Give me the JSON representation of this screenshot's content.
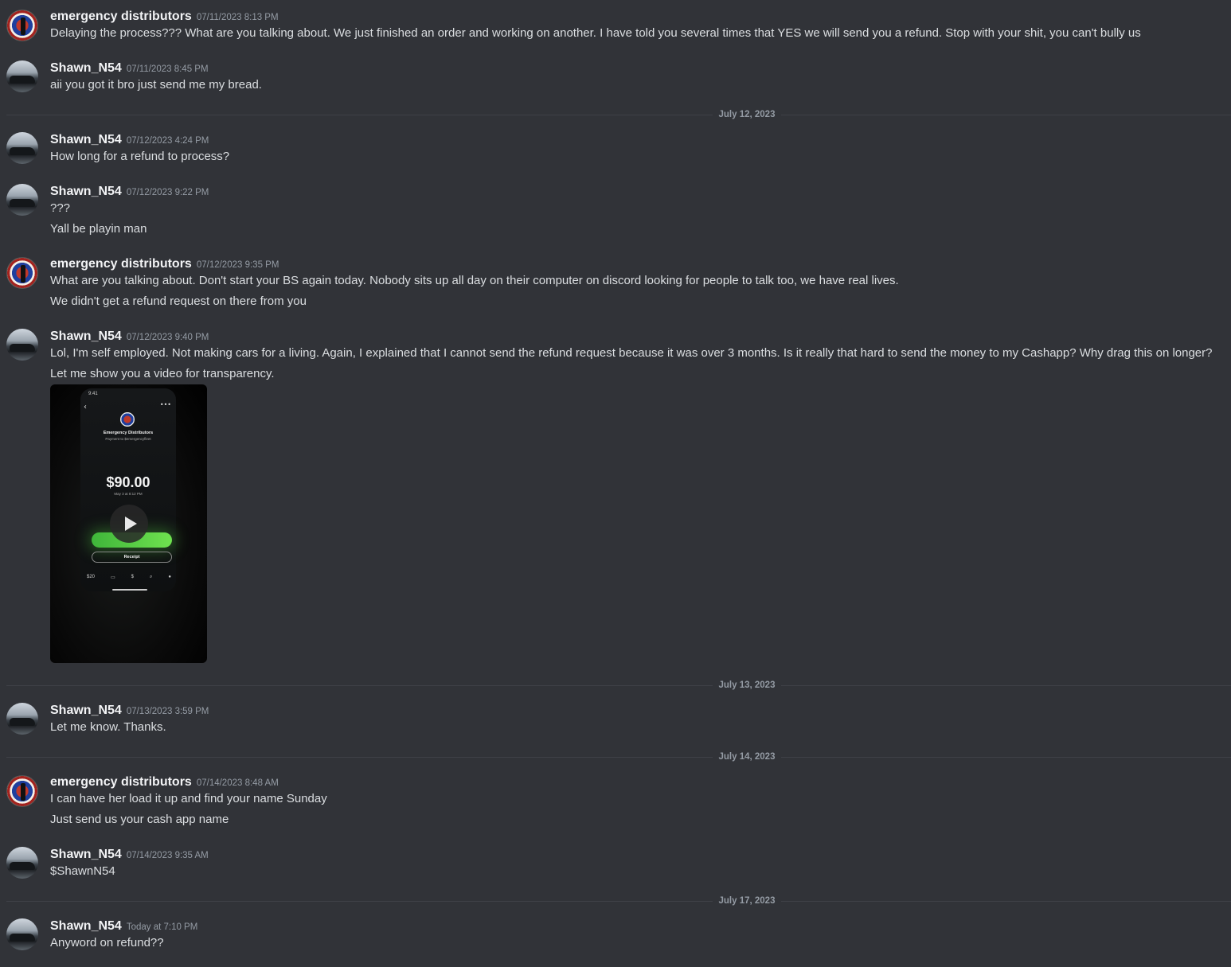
{
  "messages": [
    {
      "author": "emergency distributors",
      "avatar": "emergency-distributors-logo",
      "timestamp": "07/11/2023 8:13 PM",
      "lines": [
        "Delaying the process??? What are you talking about. We just finished an order and working on another. I have told you several times that YES we will send you a refund. Stop with your shit,  you can't bully us"
      ]
    },
    {
      "author": "Shawn_N54",
      "avatar": "car-photo",
      "timestamp": "07/11/2023 8:45 PM",
      "lines": [
        "aii you got it bro just send me my bread."
      ]
    },
    {
      "author": "Shawn_N54",
      "avatar": "car-photo",
      "timestamp": "07/12/2023 4:24 PM",
      "lines": [
        "How long for a refund to process?"
      ]
    },
    {
      "author": "Shawn_N54",
      "avatar": "car-photo",
      "timestamp": "07/12/2023 9:22 PM",
      "lines": [
        "???",
        "Yall be playin man"
      ]
    },
    {
      "author": "emergency distributors",
      "avatar": "emergency-distributors-logo",
      "timestamp": "07/12/2023 9:35 PM",
      "lines": [
        "What are you talking about. Don't start your BS again today.  Nobody sits up all day on their computer on discord looking for people to talk too, we have real lives.",
        "We didn't get a refund  request on there from you"
      ]
    },
    {
      "author": "Shawn_N54",
      "avatar": "car-photo",
      "timestamp": "07/12/2023 9:40 PM",
      "lines": [
        "Lol, I'm self employed. Not making cars for a living. Again, I explained that I cannot send the refund request because it was over 3 months. Is it really that hard to send the money to my Cashapp? Why drag this on longer?",
        "Let me show you a video for transparency."
      ],
      "video": {
        "status_time": "9:41",
        "merchant": "Emergency Distributors",
        "subtitle": "Payment to $emergencyfleet",
        "amount": "$90.00",
        "date": "May 3 at 8:12 PM",
        "receipt": "Receipt",
        "nav": [
          "$20",
          "▭",
          "$",
          "⌕",
          "●"
        ]
      }
    },
    {
      "author": "Shawn_N54",
      "avatar": "car-photo",
      "timestamp": "07/13/2023 3:59 PM",
      "lines": [
        "Let me know. Thanks."
      ]
    },
    {
      "author": "emergency distributors",
      "avatar": "emergency-distributors-logo",
      "timestamp": "07/14/2023 8:48 AM",
      "lines": [
        "I can have her load it up and find your name Sunday",
        "Just send us your cash app name"
      ]
    },
    {
      "author": "Shawn_N54",
      "avatar": "car-photo",
      "timestamp": "07/14/2023 9:35 AM",
      "lines": [
        "$ShawnN54"
      ]
    },
    {
      "author": "Shawn_N54",
      "avatar": "car-photo",
      "timestamp": "Today at 7:10 PM",
      "lines": [
        "Anyword on refund??"
      ]
    }
  ],
  "dividers": [
    "July 12, 2023",
    "July 13, 2023",
    "July 14, 2023",
    "July 17, 2023"
  ],
  "colors": {
    "background": "#313338",
    "text": "#dbdee1",
    "username": "#f2f3f5",
    "timestamp": "#949ba4",
    "divider": "#3f4147"
  }
}
